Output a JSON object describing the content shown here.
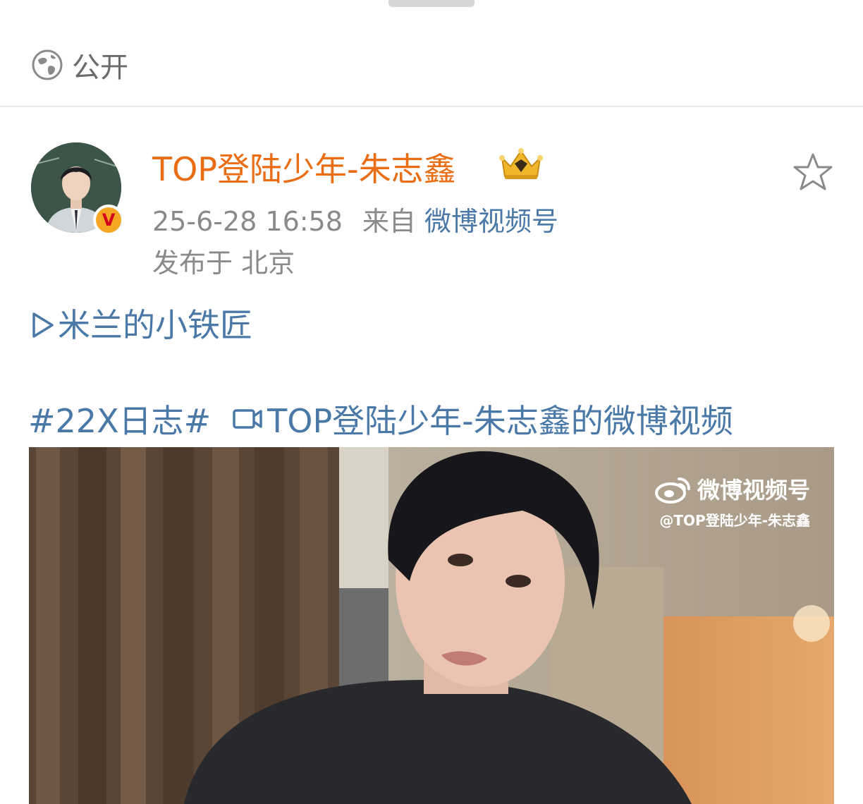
{
  "visibility": {
    "label": "公开",
    "icon": "globe-icon"
  },
  "post": {
    "author": "TOP登陆少年-朱志鑫",
    "timestamp": "25-6-28 16:58",
    "source_prefix": "来自",
    "source": "微博视频号",
    "location": "发布于 北京",
    "song": "米兰的小铁匠",
    "topic": "#22X日志#",
    "video_title": "TOP登陆少年-朱志鑫的微博视频"
  },
  "video": {
    "watermark_brand": "微博视频号",
    "watermark_handle": "@TOP登陆少年-朱志鑫"
  },
  "colors": {
    "author": "#ea6c13",
    "link": "#4a79a8",
    "meta": "#8a8a8a"
  }
}
